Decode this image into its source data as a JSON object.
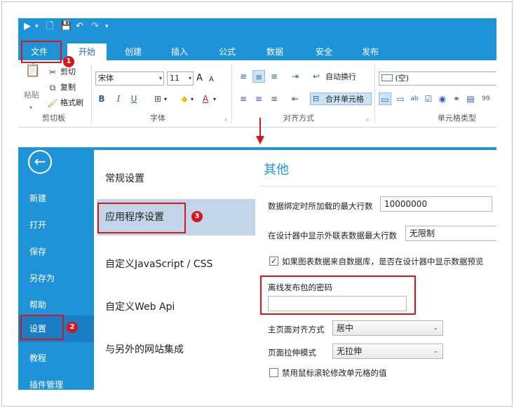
{
  "quick_access": {
    "play": "▶",
    "play_drop": "▾",
    "page": "🗋",
    "save": "💾",
    "undo": "↶",
    "redo": "↷",
    "more": "▾"
  },
  "tabs": [
    "文件",
    "开始",
    "创建",
    "插入",
    "公式",
    "数据",
    "安全",
    "发布"
  ],
  "ribbon": {
    "clipboard": {
      "paste": "粘贴",
      "cut": "剪切",
      "copy": "复制",
      "format_painter": "格式刷",
      "group": "剪切板"
    },
    "font": {
      "family": "宋体",
      "size": "11",
      "bold": "B",
      "italic": "I",
      "underline": "U",
      "grow": "A",
      "shrink": "A",
      "font_color": "A",
      "group": "字体"
    },
    "alignment": {
      "wrap": "自动换行",
      "merge": "合并单元格",
      "group": "对齐方式"
    },
    "celltype": {
      "value": "(空)",
      "group": "单元格类型"
    }
  },
  "backstage": {
    "back": "←",
    "left_items": [
      "新建",
      "打开",
      "保存",
      "另存为",
      "帮助",
      "设置",
      "教程",
      "插件管理"
    ],
    "middle_items": [
      "常规设置",
      "应用程序设置",
      "自定义JavaScript / CSS",
      "自定义Web Api",
      "与另外的网站集成"
    ],
    "right": {
      "title": "其他",
      "max_rows_label": "数据绑定时所加载的最大行数",
      "max_rows_value": "10000000",
      "designer_rows_label": "在设计器中显示外联表数据最大行数",
      "designer_rows_value": "无限制",
      "preview_checkbox": "如果图表数据来自数据库，是否在设计器中显示数据预览",
      "preview_checked": "✓",
      "password_label": "离线发布包的密码",
      "password_value": "",
      "main_align_label": "主页面对齐方式",
      "main_align_value": "居中",
      "stretch_label": "页面拉伸模式",
      "stretch_value": "无拉伸",
      "wheel_checkbox": "禁用鼠标滚轮修改单元格的值"
    }
  },
  "badges": [
    "1",
    "2",
    "3"
  ],
  "colors": {
    "accent": "#1f93d8",
    "highlight": "#d8141c",
    "selected_mid": "#c2d5e9"
  }
}
